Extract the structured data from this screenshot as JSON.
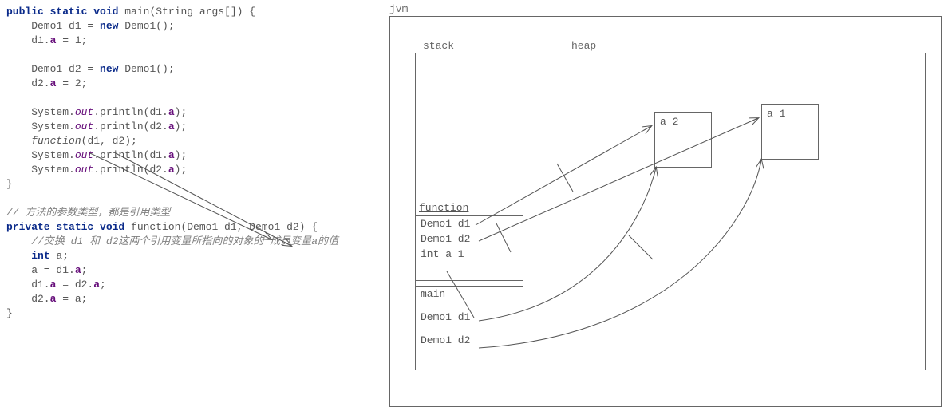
{
  "code": {
    "main_sig_pre": "public static void ",
    "main_sig_post": "main(String args[]) {",
    "l1a": "    Demo1 d1 = ",
    "new": "new",
    "l1b": " Demo1();",
    "l2a": "    d1.",
    "field_a": "a",
    "l2b": " = 1;",
    "blank": "",
    "l3a": "    Demo1 d2 = ",
    "l3b": " Demo1();",
    "l4a": "    d2.",
    "l4b": " = 2;",
    "sys": "    System.",
    "out": "out",
    "println_open": ".println(d1.",
    "println_open2": ".println(d2.",
    "close_paren": ");",
    "fn_call_pre": "    ",
    "fn_call_name": "function",
    "fn_call_args": "(d1, d2);",
    "close_brace": "}",
    "comment1": "// 方法的参数类型，都是引用类型",
    "fn_sig_pre": "private static void ",
    "fn_sig_post": "function(Demo1 d1, Demo1 d2) {",
    "comment2": "    //交换 d1 和 d2这两个引用变量所指向的对象的 成员变量a的值",
    "int_decl_pre": "    ",
    "int_kw": "int",
    "int_decl_post": " a;",
    "swap1a": "    a = d1.",
    "swap1b": ";",
    "swap2a": "    d1.",
    "swap2b": " = d2.",
    "swap3a": "    d2.",
    "swap3b": " = a;"
  },
  "diagram": {
    "jvm": "jvm",
    "stack": "stack",
    "heap": "heap",
    "fn_title": "function",
    "fn_r1": "Demo1 d1",
    "fn_r2": "Demo1 d2",
    "fn_r3": "int a 1",
    "main_title": "main",
    "main_r1": "Demo1 d1",
    "main_r2": "Demo1 d2",
    "obj1": "a 2",
    "obj2": "a 1"
  }
}
